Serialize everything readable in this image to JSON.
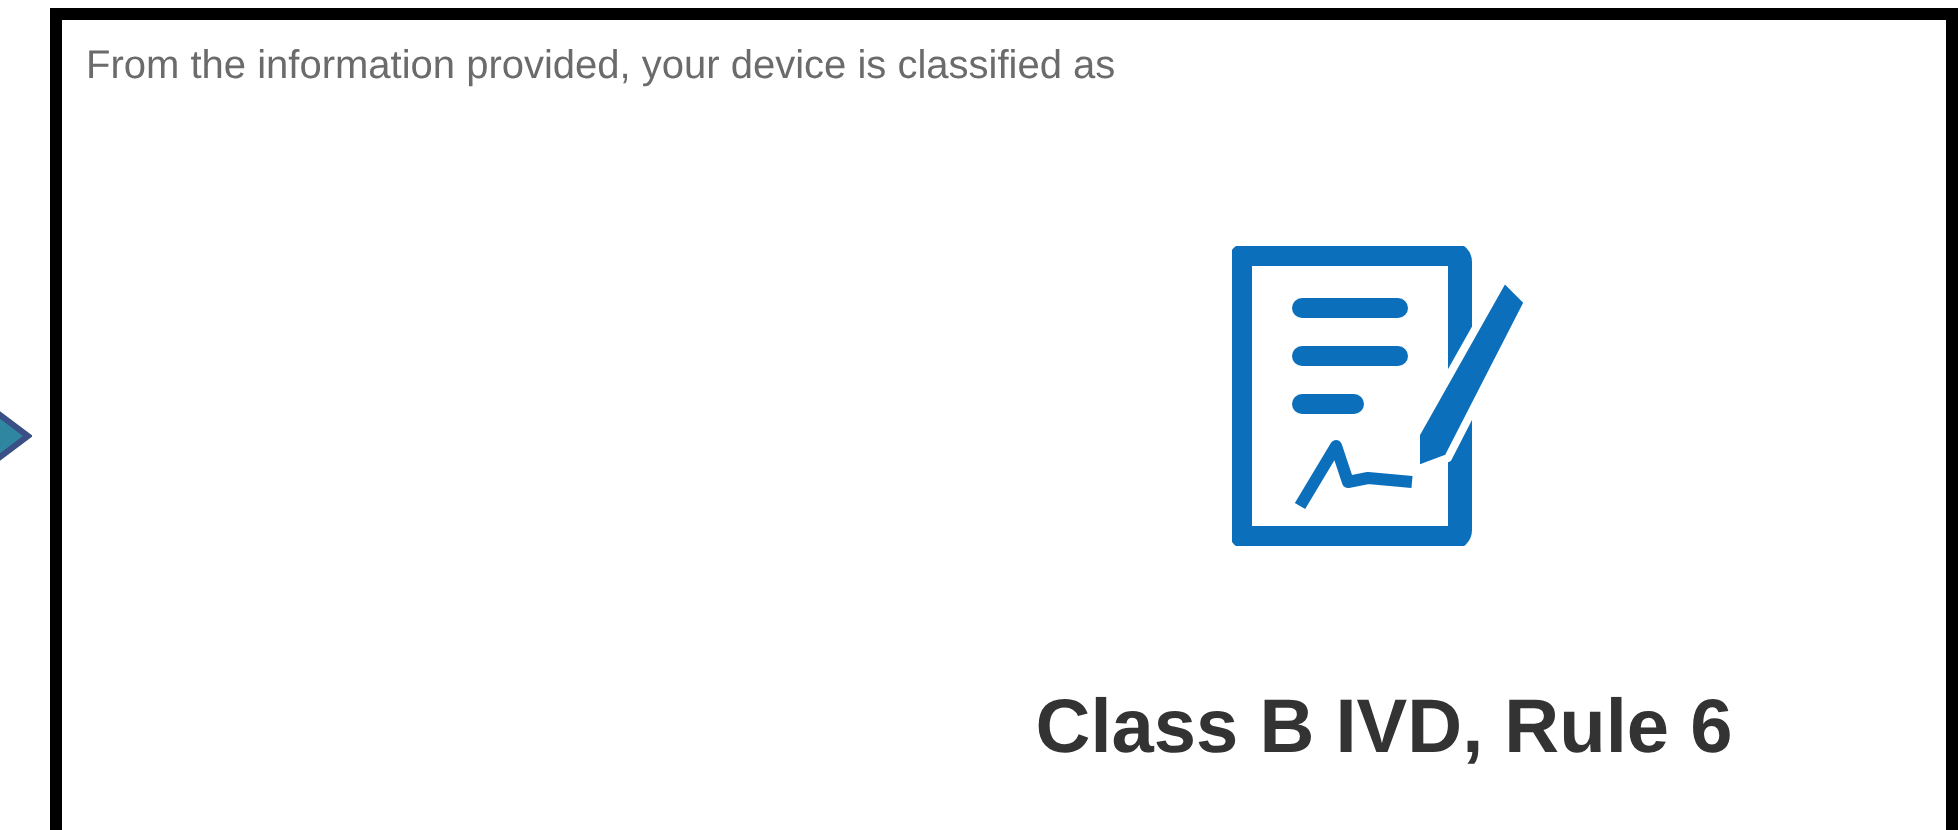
{
  "intro": "From the information provided, your device is classified as",
  "result": {
    "title": "Class B IVD, Rule 6"
  }
}
